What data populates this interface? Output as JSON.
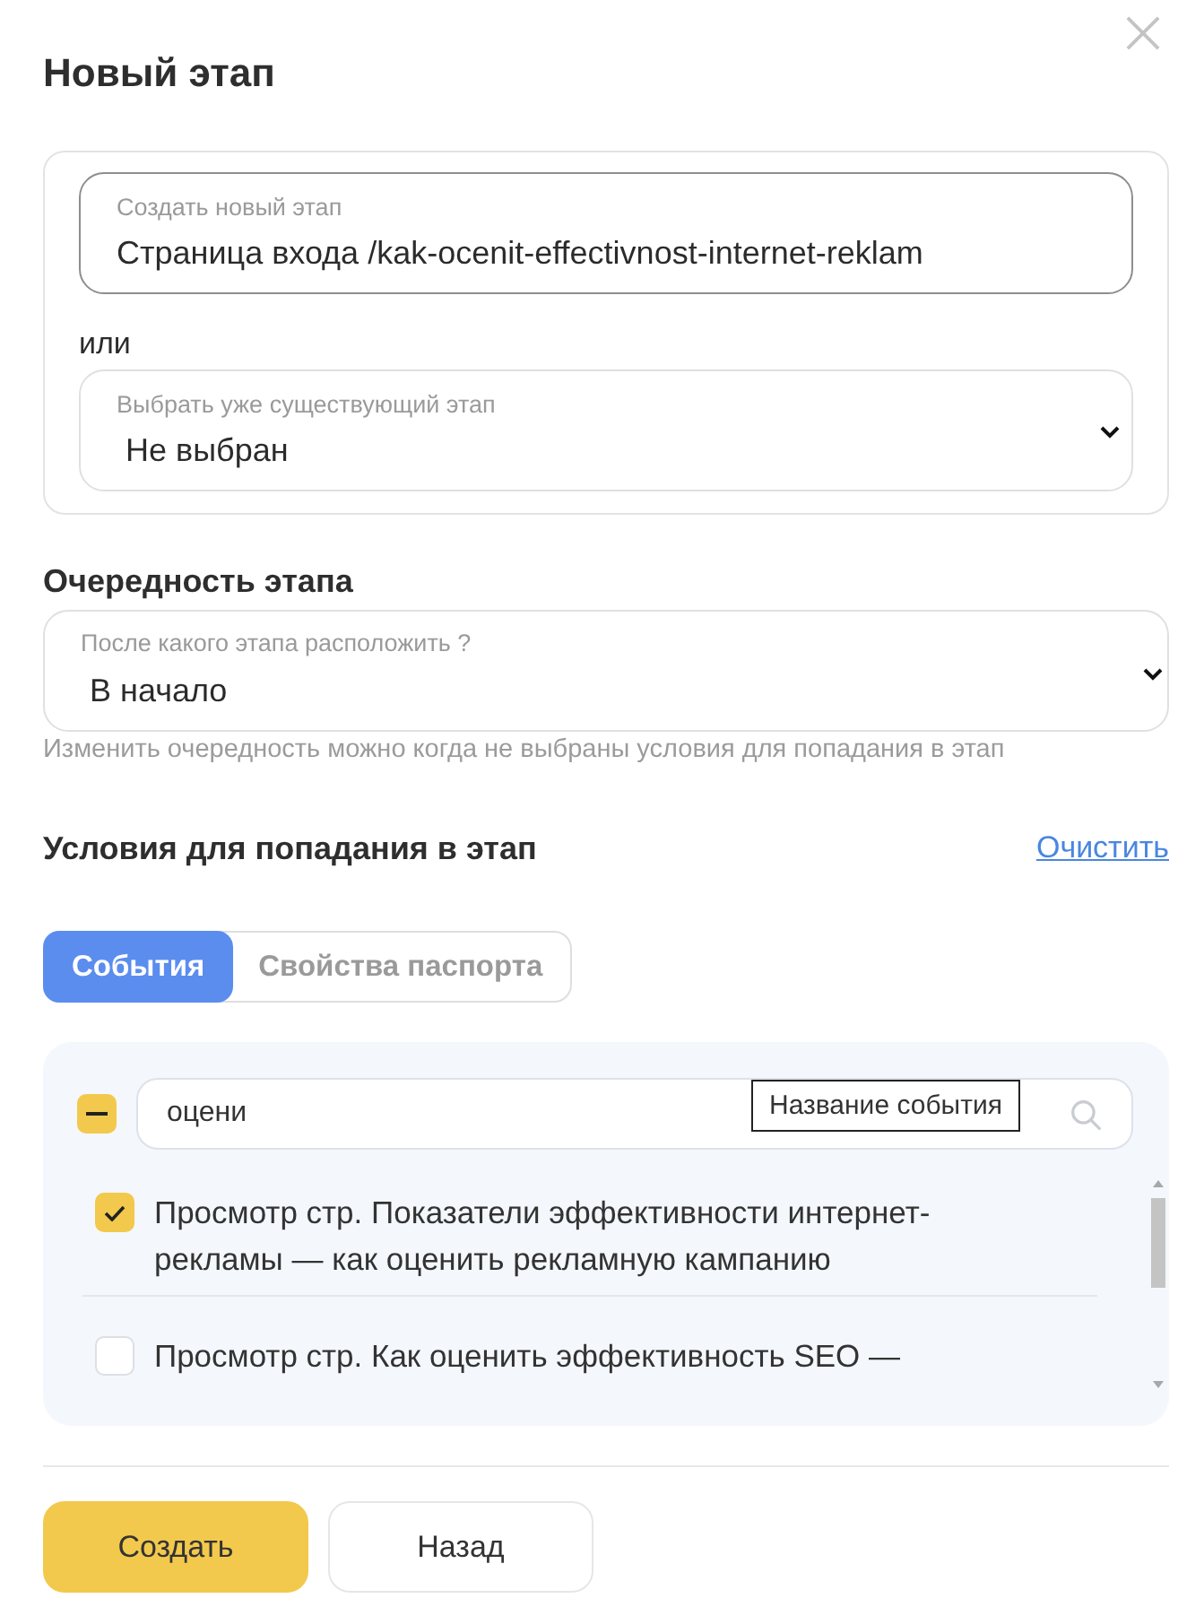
{
  "dialog": {
    "title": "Новый этап"
  },
  "stage": {
    "create_field": {
      "label": "Создать новый этап",
      "value": "Страница входа /kak-ocenit-effectivnost-internet-reklam",
      "focused": true
    },
    "or_text": "или",
    "existing_select": {
      "label": "Выбрать уже существующий этап",
      "value": "Не выбран"
    }
  },
  "order": {
    "heading": "Очередность этапа",
    "select": {
      "label": "После какого этапа расположить ?",
      "value": "В начало"
    },
    "hint": "Изменить очередность можно когда не выбраны условия для попадания в этап"
  },
  "conditions": {
    "heading": "Условия для попадания в этап",
    "clear_link": "Очистить",
    "tabs": [
      {
        "label": "События",
        "selected": true
      },
      {
        "label": "Свойства паспорта",
        "selected": false
      }
    ],
    "select_all": {
      "indeterminate": true
    },
    "search": {
      "value": "оцени",
      "tooltip": "Название события"
    },
    "events": [
      {
        "label": "Просмотр стр. Показатели эффективности интернет-рекламы — как оценить рекламную кампанию",
        "checked": true
      },
      {
        "label": "Просмотр стр. Как оценить эффективность SEO —",
        "checked": false
      }
    ]
  },
  "buttons": [
    {
      "label": "Создать",
      "kind": "primary"
    },
    {
      "label": "Назад",
      "kind": "secondary"
    }
  ]
}
